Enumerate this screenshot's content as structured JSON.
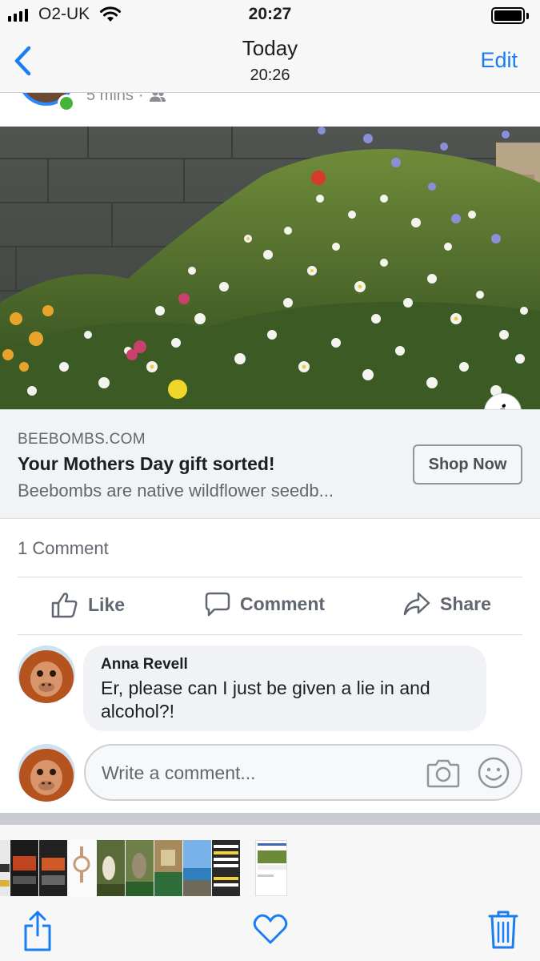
{
  "status_bar": {
    "carrier": "O2-UK",
    "time": "20:27"
  },
  "nav": {
    "title": "Today",
    "subtitle": "20:26",
    "edit_label": "Edit"
  },
  "post": {
    "meta_time": "5 mins",
    "meta_sep": "·",
    "audience_icon": "friends-icon"
  },
  "ad": {
    "domain": "BEEBOMBS.COM",
    "headline": "Your Mothers Day gift sorted!",
    "description": "Beebombs are native wildflower seedb...",
    "cta_label": "Shop Now"
  },
  "engagement": {
    "comment_count": "1 Comment",
    "like_label": "Like",
    "comment_label": "Comment",
    "share_label": "Share"
  },
  "comment": {
    "author": "Anna Revell",
    "text": "Er, please can I just be given a lie in and alcohol?!"
  },
  "composer": {
    "placeholder": "Write a comment..."
  },
  "colors": {
    "accent": "#1a7ef2",
    "online": "#44b53a",
    "ring": "#2d88ff"
  },
  "thumbnails": [
    "keyboard-screen",
    "car-display",
    "car-display",
    "watch-ad",
    "birds",
    "statue",
    "shop-interior",
    "beach-sea",
    "exit-warning-text",
    "current-post"
  ]
}
